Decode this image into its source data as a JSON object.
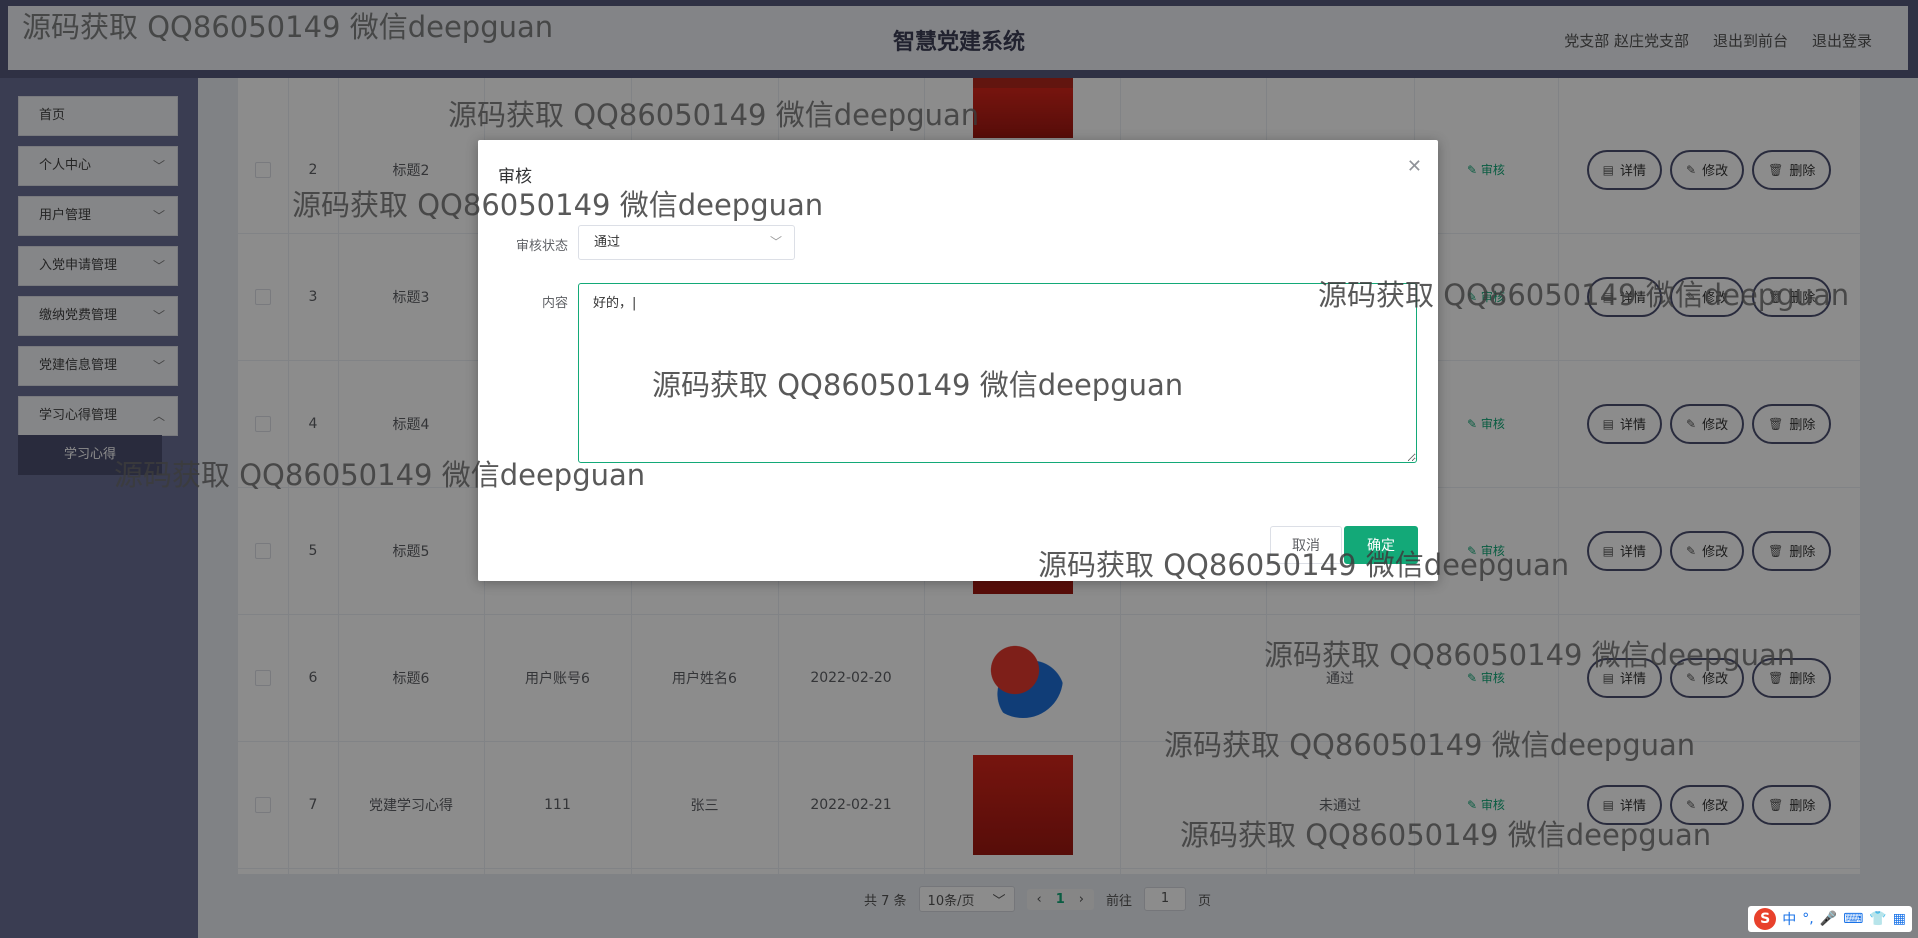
{
  "header": {
    "title": "智慧党建系统",
    "branch": "党支部 赵庄党支部",
    "front_link": "退出到前台",
    "logout_link": "退出登录"
  },
  "sidebar": {
    "items": [
      {
        "label": "首页",
        "has_chevron": false
      },
      {
        "label": "个人中心",
        "has_chevron": true
      },
      {
        "label": "用户管理",
        "has_chevron": true
      },
      {
        "label": "入党申请管理",
        "has_chevron": true
      },
      {
        "label": "缴纳党费管理",
        "has_chevron": true
      },
      {
        "label": "党建信息管理",
        "has_chevron": true
      },
      {
        "label": "学习心得管理",
        "has_chevron": true
      }
    ],
    "active_sub": "学习心得"
  },
  "table": {
    "rows": [
      {
        "idx": "2",
        "title": "标题2",
        "account": "",
        "name": "",
        "date": "",
        "status": "",
        "audit": "审核"
      },
      {
        "idx": "3",
        "title": "标题3",
        "account": "",
        "name": "",
        "date": "",
        "status": "",
        "audit": "审核"
      },
      {
        "idx": "4",
        "title": "标题4",
        "account": "",
        "name": "",
        "date": "",
        "status": "",
        "audit": "审核"
      },
      {
        "idx": "5",
        "title": "标题5",
        "account": "",
        "name": "",
        "date": "",
        "status": "",
        "audit": "审核"
      },
      {
        "idx": "6",
        "title": "标题6",
        "account": "用户账号6",
        "name": "用户姓名6",
        "date": "2022-02-20",
        "status": "通过",
        "audit": "审核"
      },
      {
        "idx": "7",
        "title": "党建学习心得",
        "account": "111",
        "name": "张三",
        "date": "2022-02-21",
        "status": "未通过",
        "audit": "审核"
      }
    ],
    "actions": {
      "detail": "详情",
      "edit": "修改",
      "delete": "删除"
    }
  },
  "pager": {
    "total": "共 7 条",
    "page_size": "10条/页",
    "current": "1",
    "goto_label": "前往",
    "goto_value": "1",
    "page_unit": "页"
  },
  "modal": {
    "title": "审核",
    "status_label": "审核状态",
    "status_value": "通过",
    "content_label": "内容",
    "content_value": "好的，|",
    "cancel": "取消",
    "confirm": "确定"
  },
  "watermark": "源码获取 QQ86050149 微信deepguan",
  "ime": {
    "s": "S",
    "lang": "中",
    "punct": "°,"
  },
  "colors": {
    "accent": "#13a978",
    "sidebar": "#6a6f95",
    "topbar": "#565a7c"
  }
}
